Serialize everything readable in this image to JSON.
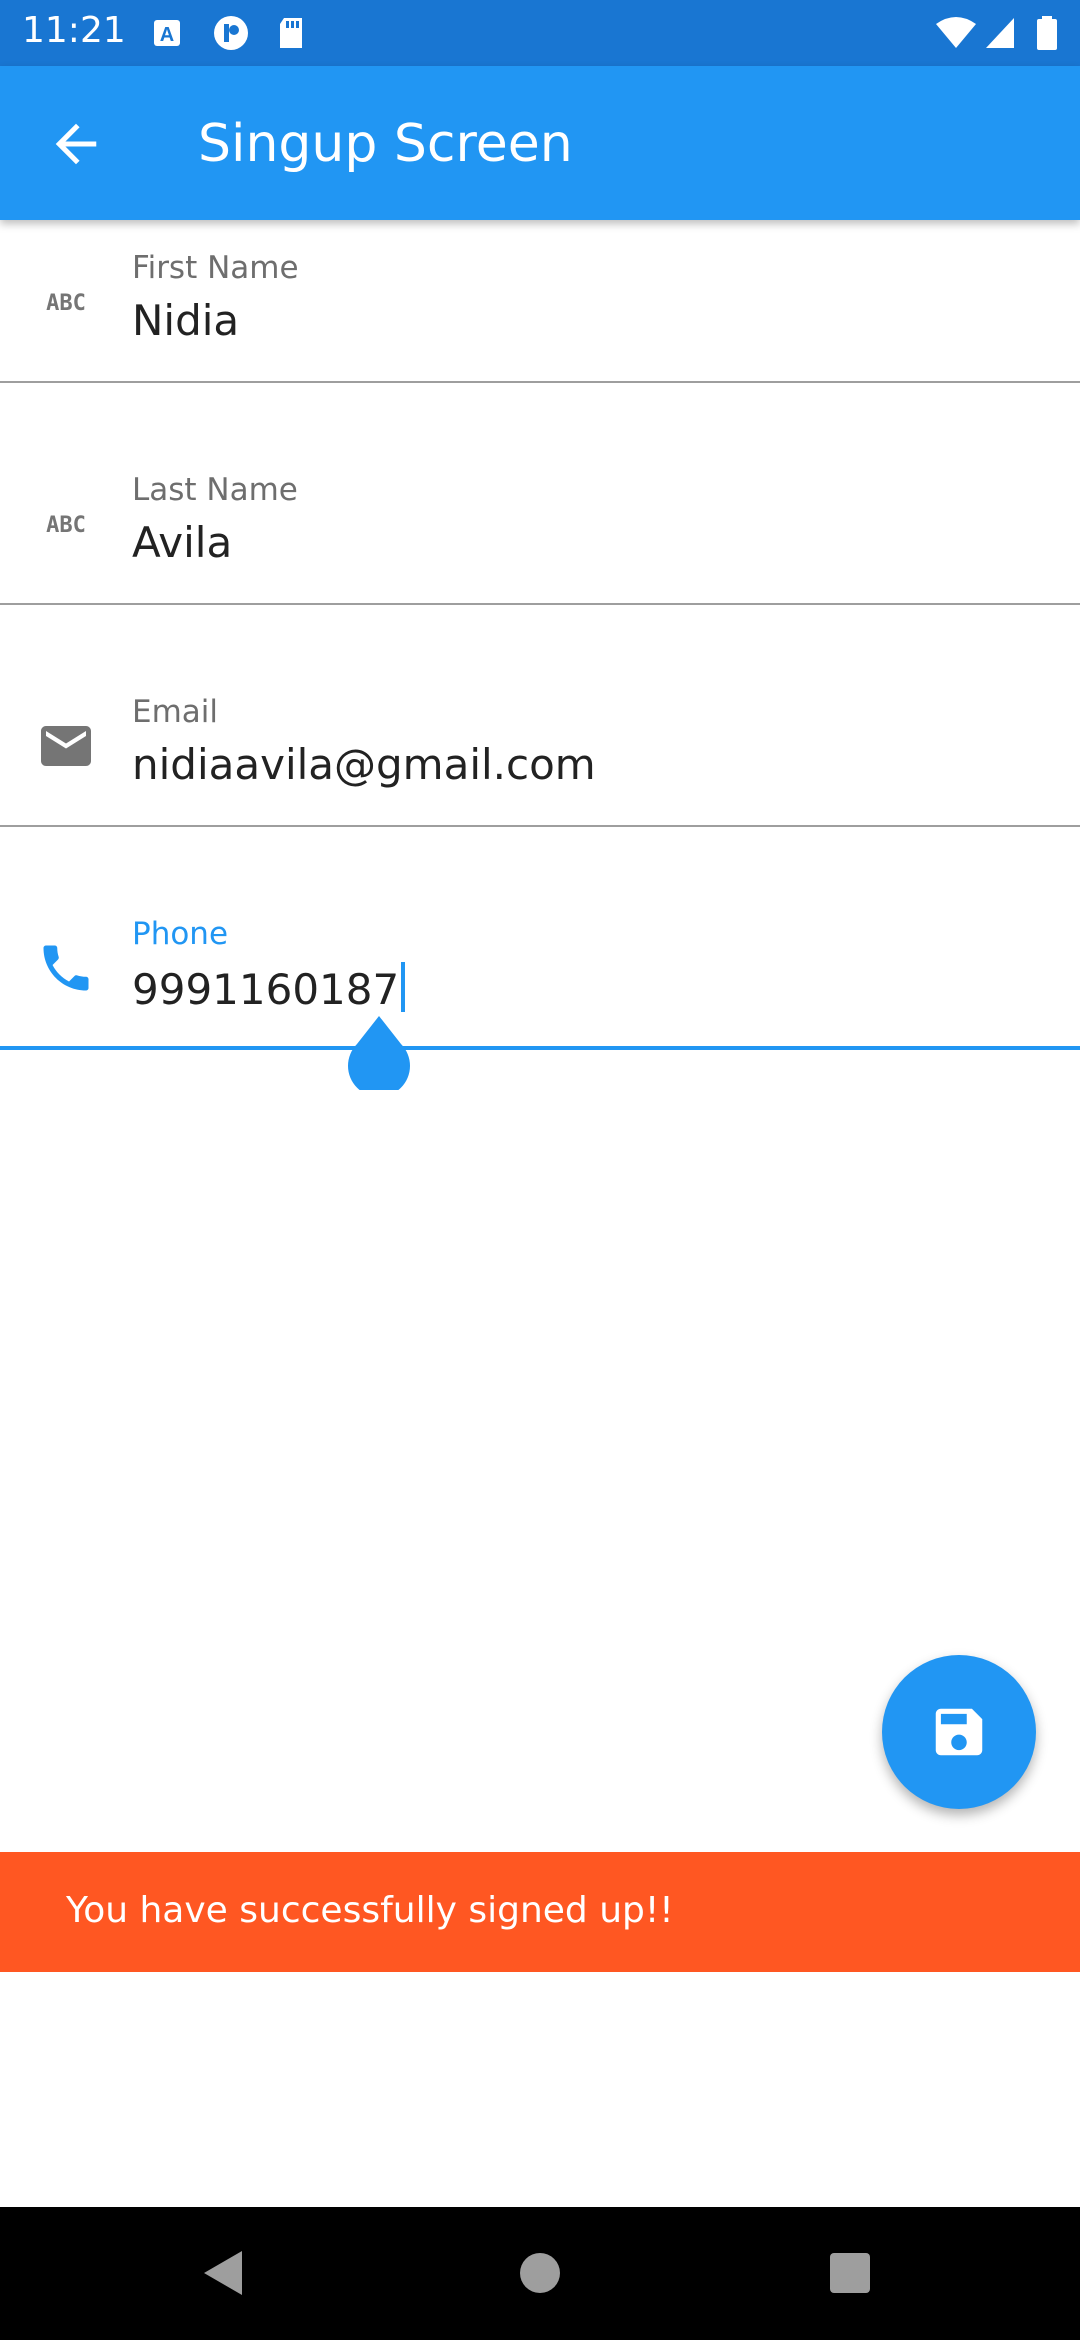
{
  "status_bar": {
    "time": "11:21",
    "left_icons": [
      "a-icon",
      "circle-app-icon",
      "sd-card-icon"
    ],
    "right_icons": [
      "wifi-icon",
      "cell-signal-icon",
      "battery-icon"
    ]
  },
  "app_bar": {
    "back_icon": "arrow-back-icon",
    "title": "Singup Screen",
    "color": "#2196f3"
  },
  "form": {
    "first_name": {
      "label": "First Name",
      "value": "Nidia",
      "icon": "abc-icon"
    },
    "last_name": {
      "label": "Last Name",
      "value": "Avila",
      "icon": "abc-icon"
    },
    "email": {
      "label": "Email",
      "value": "nidiaavila@gmail.com",
      "icon": "mail-icon"
    },
    "phone": {
      "label": "Phone",
      "value": "9991160187",
      "icon": "phone-icon",
      "focused": true
    }
  },
  "fab": {
    "icon": "save-icon"
  },
  "snackbar": {
    "message": "You have successfully signed up!!",
    "color": "#ff5722"
  },
  "nav_bar": {
    "buttons": [
      "back-triangle-icon",
      "home-circle-icon",
      "recents-square-icon"
    ]
  }
}
